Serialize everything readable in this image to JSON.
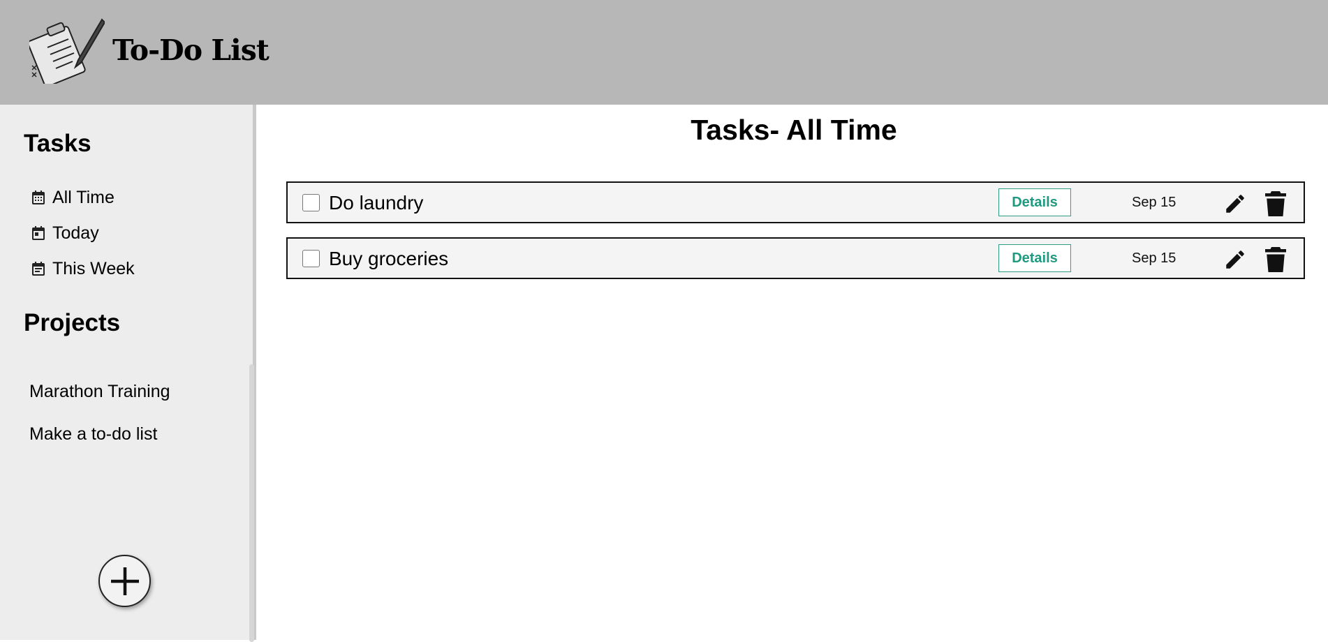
{
  "header": {
    "app_title": "To-Do List"
  },
  "sidebar": {
    "tasks_heading": "Tasks",
    "task_filters": [
      {
        "label": "All Time",
        "icon": "calendar-month-icon"
      },
      {
        "label": "Today",
        "icon": "calendar-today-icon"
      },
      {
        "label": "This Week",
        "icon": "calendar-week-icon"
      }
    ],
    "projects_heading": "Projects",
    "projects": [
      {
        "label": "Marathon Training"
      },
      {
        "label": "Make a to-do list"
      }
    ],
    "add_button_icon": "plus-icon"
  },
  "main": {
    "title": "Tasks- All Time",
    "tasks": [
      {
        "name": "Do laundry",
        "details_label": "Details",
        "date": "Sep 15",
        "completed": false
      },
      {
        "name": "Buy groceries",
        "details_label": "Details",
        "date": "Sep 15",
        "completed": false
      }
    ]
  },
  "colors": {
    "header_bg": "#b7b7b7",
    "sidebar_bg": "#ededed",
    "details_accent": "#1f9a80"
  }
}
